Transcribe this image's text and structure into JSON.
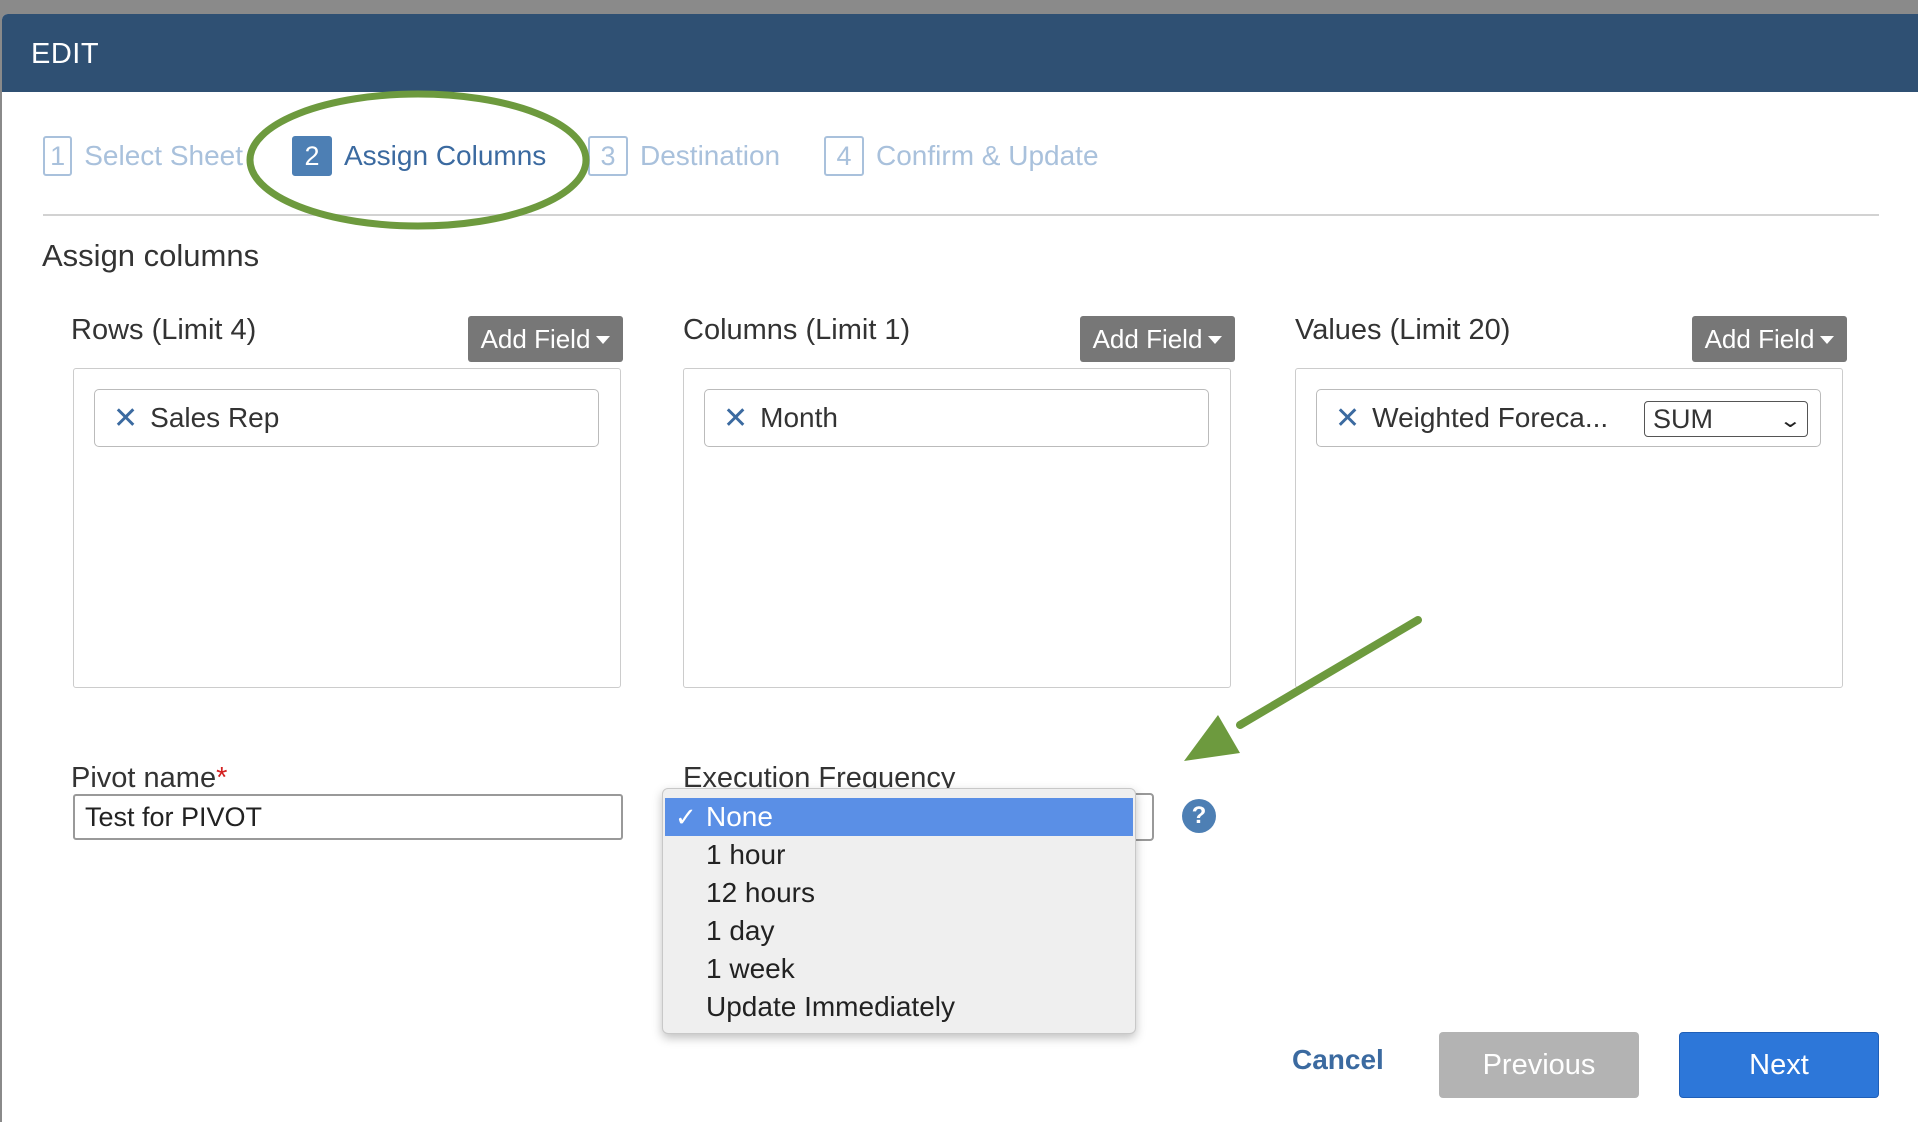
{
  "header": {
    "title": "EDIT"
  },
  "steps": [
    {
      "num": "1",
      "label": "Select Sheet"
    },
    {
      "num": "2",
      "label": "Assign Columns"
    },
    {
      "num": "3",
      "label": "Destination"
    },
    {
      "num": "4",
      "label": "Confirm & Update"
    }
  ],
  "section_title": "Assign columns",
  "panels": {
    "rows": {
      "title": "Rows (Limit 4)",
      "add_label": "Add Field",
      "chip": "Sales Rep"
    },
    "columns": {
      "title": "Columns (Limit 1)",
      "add_label": "Add Field",
      "chip": "Month"
    },
    "values": {
      "title": "Values (Limit 20)",
      "add_label": "Add Field",
      "chip": "Weighted Foreca...",
      "aggregate": "SUM"
    }
  },
  "pivot_name": {
    "label": "Pivot name",
    "required_mark": "*",
    "value": "Test for PIVOT"
  },
  "execution_frequency": {
    "label": "Execution Frequency",
    "options": [
      "None",
      "1 hour",
      "12 hours",
      "1 day",
      "1 week",
      "Update Immediately"
    ],
    "selected": "None"
  },
  "help_icon": "?",
  "footer": {
    "cancel": "Cancel",
    "previous": "Previous",
    "next": "Next"
  },
  "colors": {
    "header": "#2f5073",
    "accent": "#2d77d9",
    "annotation": "#6d9a3e"
  }
}
